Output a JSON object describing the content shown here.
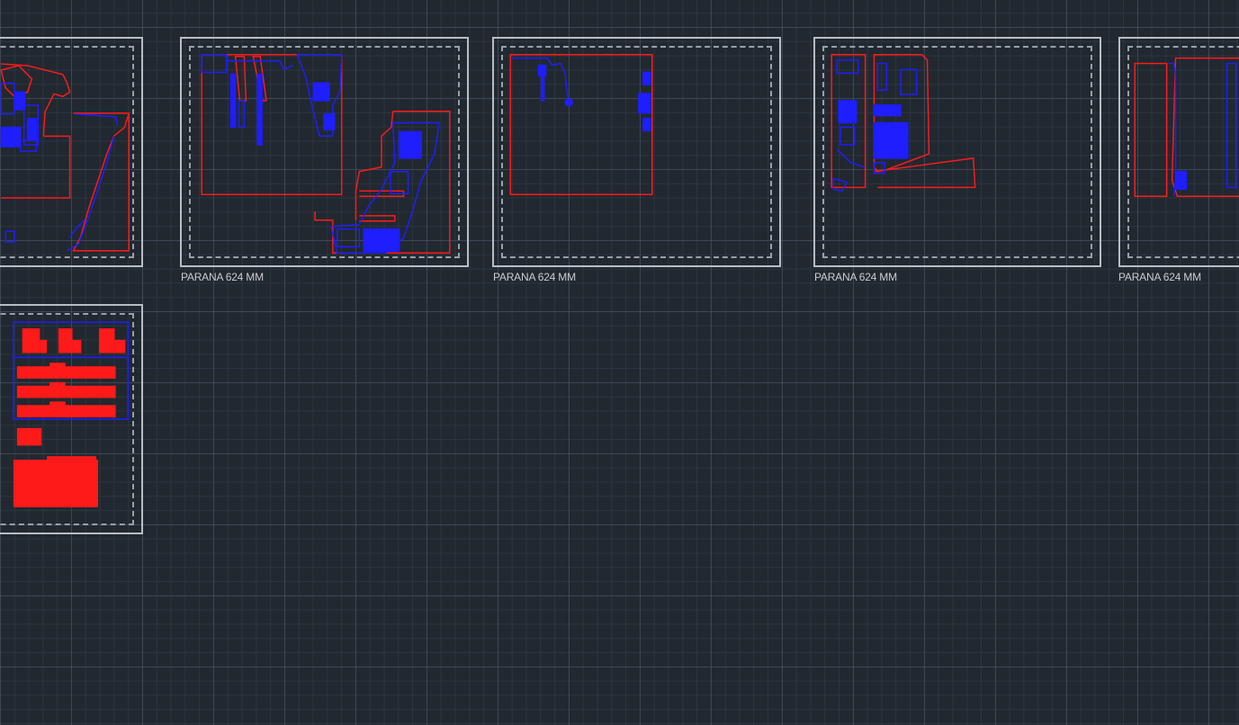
{
  "canvas": {
    "background_color": "#212830",
    "grid_major_color": "#4b5867",
    "grid_minor_color": "#343d48",
    "sheet_border_color": "#b9bec4",
    "geometry_colors": {
      "red": "#ff1a1a",
      "blue": "#1e1eff"
    }
  },
  "sheets": [
    {
      "id": "sheet-1",
      "label": ""
    },
    {
      "id": "sheet-2",
      "label": "PARANA 624 MM"
    },
    {
      "id": "sheet-3",
      "label": "PARANA 624 MM"
    },
    {
      "id": "sheet-4",
      "label": "PARANA 624 MM"
    },
    {
      "id": "sheet-5",
      "label": "PARANA 624 MM"
    },
    {
      "id": "sheet-6",
      "label": ""
    }
  ]
}
